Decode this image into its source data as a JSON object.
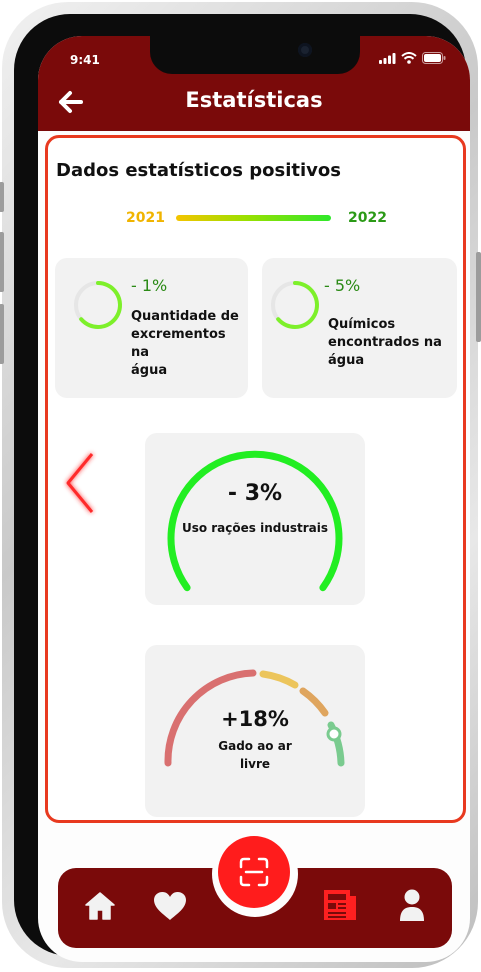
{
  "status_bar": {
    "time": "9:41"
  },
  "header": {
    "title": "Estatísticas"
  },
  "panel": {
    "heading": "Dados estatísticos positivos",
    "year_start": "2021",
    "year_end": "2022"
  },
  "cards": [
    {
      "percent": "- 1%",
      "label_lines": [
        "Quantidade de",
        "excrementos na",
        "água"
      ]
    },
    {
      "percent": "- 5%",
      "label_lines": [
        "Químicos",
        "encontrados na",
        "água"
      ]
    }
  ],
  "gauge_main": {
    "value": "- 3%",
    "label": "Uso rações industrais"
  },
  "gauge_secondary": {
    "value": "+18%",
    "label_lines": [
      "Gado ao ar",
      "livre"
    ]
  },
  "colors": {
    "header_bg": "#7a0a0a",
    "panel_border": "#e8391f",
    "positive_green": "#2b8a16",
    "fab_red": "#ff1c1c",
    "gauge_green": "#22ee22"
  },
  "icons": {
    "back": "arrow-left-icon",
    "prev": "chevron-left-icon",
    "scan": "scan-icon",
    "home": "home-icon",
    "favorites": "heart-icon",
    "news": "newspaper-icon",
    "profile": "user-icon"
  }
}
